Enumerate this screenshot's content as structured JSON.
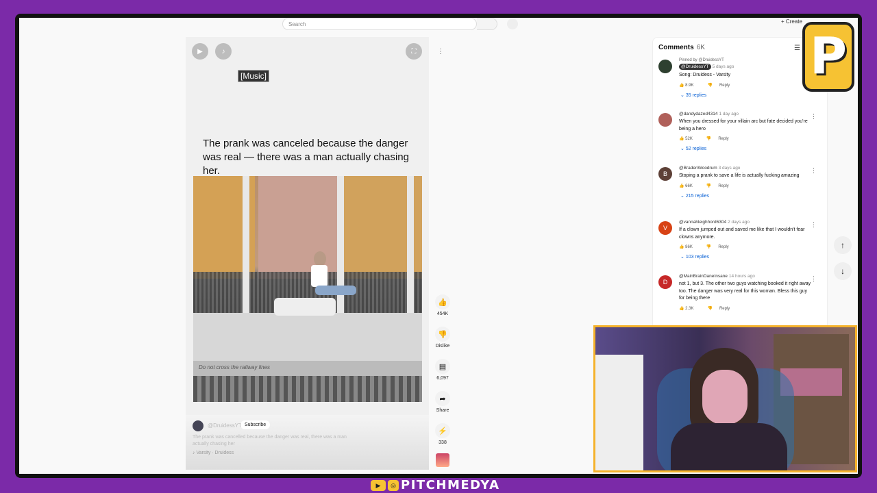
{
  "search": {
    "placeholder": "Search"
  },
  "topbar": {
    "create_label": "Create"
  },
  "player": {
    "music_tag": "[Music]",
    "caption": "The prank was canceled because the danger was real — there was a man actually chasing her.",
    "platform_text": "Do not cross the railway lines"
  },
  "actions": {
    "like_count": "454K",
    "dislike_label": "Dislike",
    "comment_count": "6,097",
    "share_label": "Share",
    "remix_count": "338"
  },
  "meta": {
    "channel": "@DruidessYT",
    "subscribe_label": "Subscribe",
    "description": "The prank was cancelled because the danger was real, there was a man actually chasing her",
    "song": "Varsity · Druidess"
  },
  "comments": {
    "title": "Comments",
    "count": "6K",
    "items": [
      {
        "pinned": "Pinned by @DruidessYT",
        "author": "@DruidessYT",
        "time": "5 days ago",
        "text": "Song: Druidess - Varsity",
        "likes": "8.9K",
        "replies": "35 replies",
        "avatar_letter": "",
        "avatar_color": "#2e4030"
      },
      {
        "pinned": "",
        "author": "@dandydazed4314",
        "time": "1 day ago",
        "text": "When you dressed for your villain arc but fate decided you're being a hero",
        "likes": "52K",
        "replies": "52 replies",
        "avatar_letter": "",
        "avatar_color": "#b0605a"
      },
      {
        "pinned": "",
        "author": "@BradenWoodrum",
        "time": "3 days ago",
        "text": "Stoping a prank to save a life is actually fucking amazing",
        "likes": "66K",
        "replies": "215 replies",
        "avatar_letter": "B",
        "avatar_color": "#5d4037"
      },
      {
        "pinned": "",
        "author": "@vannahleighhord6304",
        "time": "2 days ago",
        "text": "If a clown jumped out and saved me like that I wouldn't fear clowns anymore.",
        "likes": "86K",
        "replies": "103 replies",
        "avatar_letter": "V",
        "avatar_color": "#d84315"
      },
      {
        "pinned": "",
        "author": "@MainBrainDaneInsane",
        "time": "14 hours ago",
        "text": "not 1, but 3. The other two guys watching booked it right away too. The danger was very real for this woman. Bless this guy for being there",
        "likes": "2.3K",
        "replies": "",
        "avatar_letter": "D",
        "avatar_color": "#c62828"
      }
    ],
    "reply_label": "Reply"
  },
  "brand": {
    "name": "PITCHMEDYA",
    "logo_letter": "P"
  },
  "colors": {
    "frame_bg": "#7b2aa8",
    "accent": "#f6c233",
    "link": "#065fd4"
  }
}
